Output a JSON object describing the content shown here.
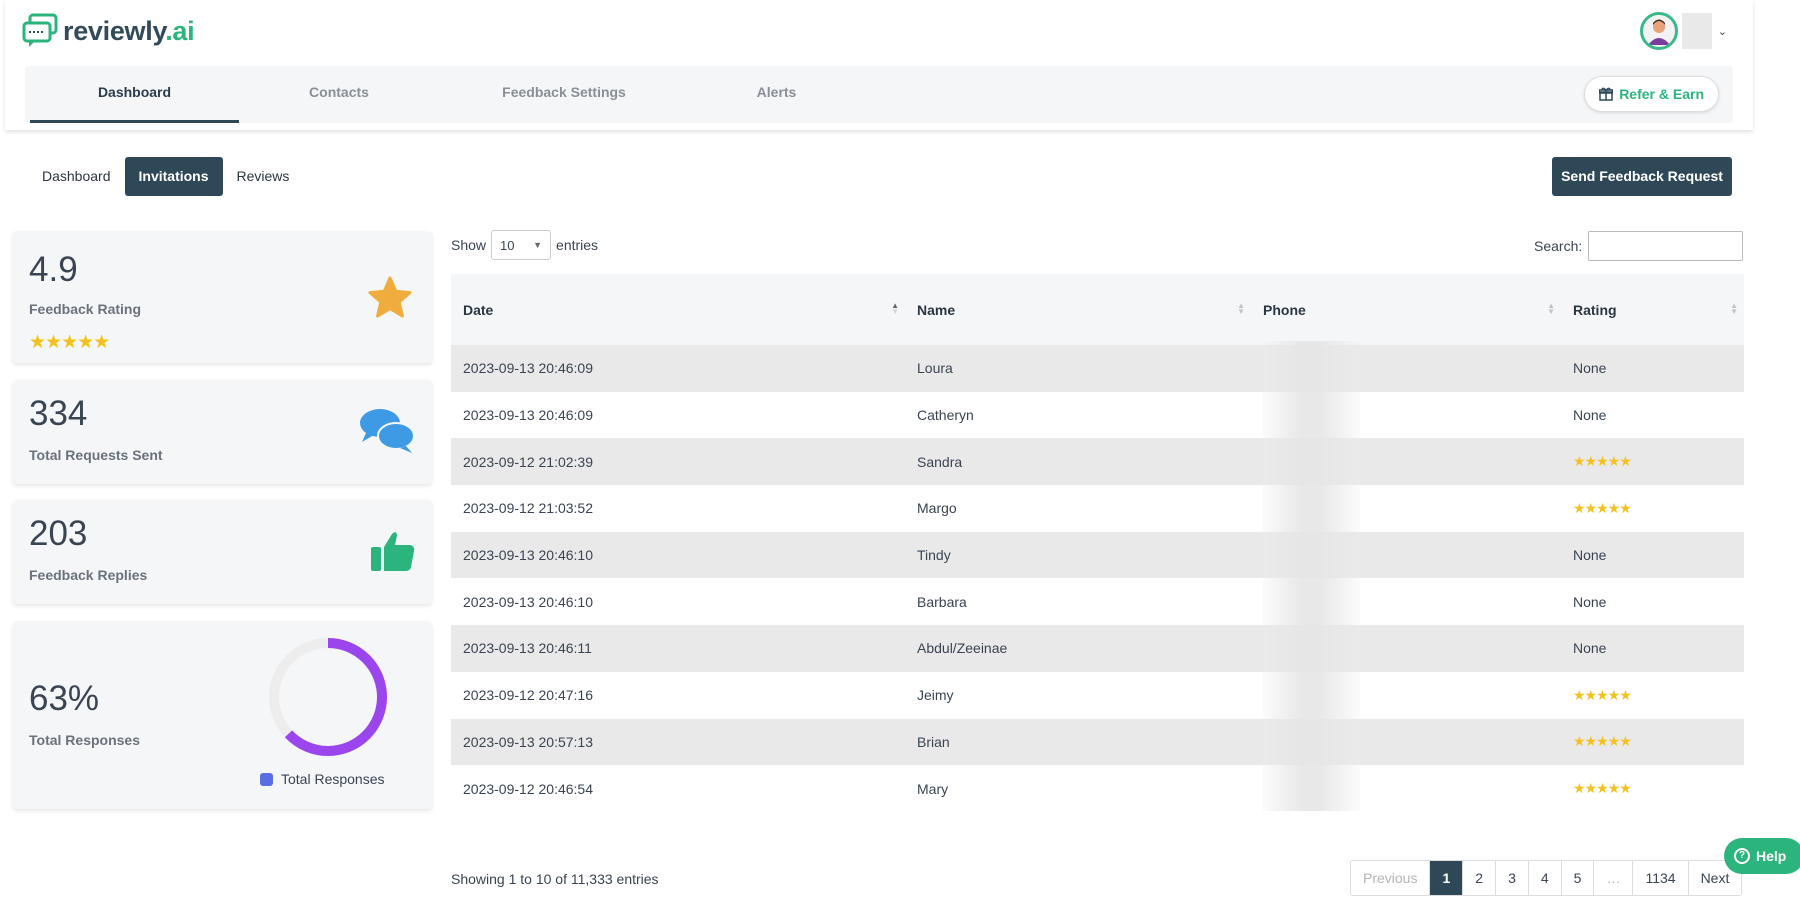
{
  "brand": {
    "name": "reviewly",
    "suffix": ".ai"
  },
  "nav": {
    "tabs": [
      {
        "label": "Dashboard",
        "active": true
      },
      {
        "label": "Contacts",
        "active": false
      },
      {
        "label": "Feedback Settings",
        "active": false
      },
      {
        "label": "Alerts",
        "active": false
      }
    ],
    "refer_label": "Refer & Earn"
  },
  "subtabs": [
    {
      "label": "Dashboard",
      "active": false
    },
    {
      "label": "Invitations",
      "active": true
    },
    {
      "label": "Reviews",
      "active": false
    }
  ],
  "send_button": "Send Feedback Request",
  "stats": {
    "rating": {
      "value": "4.9",
      "label": "Feedback Rating",
      "stars": "★★★★★"
    },
    "requests": {
      "value": "334",
      "label": "Total Requests Sent"
    },
    "replies": {
      "value": "203",
      "label": "Feedback Replies"
    },
    "responses": {
      "value": "63%",
      "label": "Total Responses",
      "legend": "Total Responses",
      "fraction": 0.63
    }
  },
  "table_controls": {
    "show_label": "Show",
    "entries_value": "10",
    "entries_label": "entries",
    "search_label": "Search:"
  },
  "table": {
    "columns": [
      "Date",
      "Name",
      "Phone",
      "Rating"
    ],
    "rows": [
      {
        "date": "2023-09-13 20:46:09",
        "name": "Loura",
        "rating": "None"
      },
      {
        "date": "2023-09-13 20:46:09",
        "name": "Catheryn",
        "rating": "None"
      },
      {
        "date": "2023-09-12 21:02:39",
        "name": "Sandra",
        "rating": "★★★★★"
      },
      {
        "date": "2023-09-12 21:03:52",
        "name": "Margo",
        "rating": "★★★★★"
      },
      {
        "date": "2023-09-13 20:46:10",
        "name": "Tindy",
        "rating": "None"
      },
      {
        "date": "2023-09-13 20:46:10",
        "name": "Barbara",
        "rating": "None"
      },
      {
        "date": "2023-09-13 20:46:11",
        "name": "Abdul/Zeeinae",
        "rating": "None"
      },
      {
        "date": "2023-09-12 20:47:16",
        "name": "Jeimy",
        "rating": "★★★★★"
      },
      {
        "date": "2023-09-13 20:57:13",
        "name": "Brian",
        "rating": "★★★★★"
      },
      {
        "date": "2023-09-12 20:46:54",
        "name": "Mary",
        "rating": "★★★★★"
      }
    ]
  },
  "footer": {
    "info": "Showing 1 to 10 of 11,333 entries",
    "pages": [
      "Previous",
      "1",
      "2",
      "3",
      "4",
      "5",
      "…",
      "1134",
      "Next"
    ]
  },
  "help_label": "Help",
  "colors": {
    "primary": "#2f4858",
    "accent": "#2bb57d",
    "star": "#f4c21e",
    "donut": "#9b45ec"
  }
}
